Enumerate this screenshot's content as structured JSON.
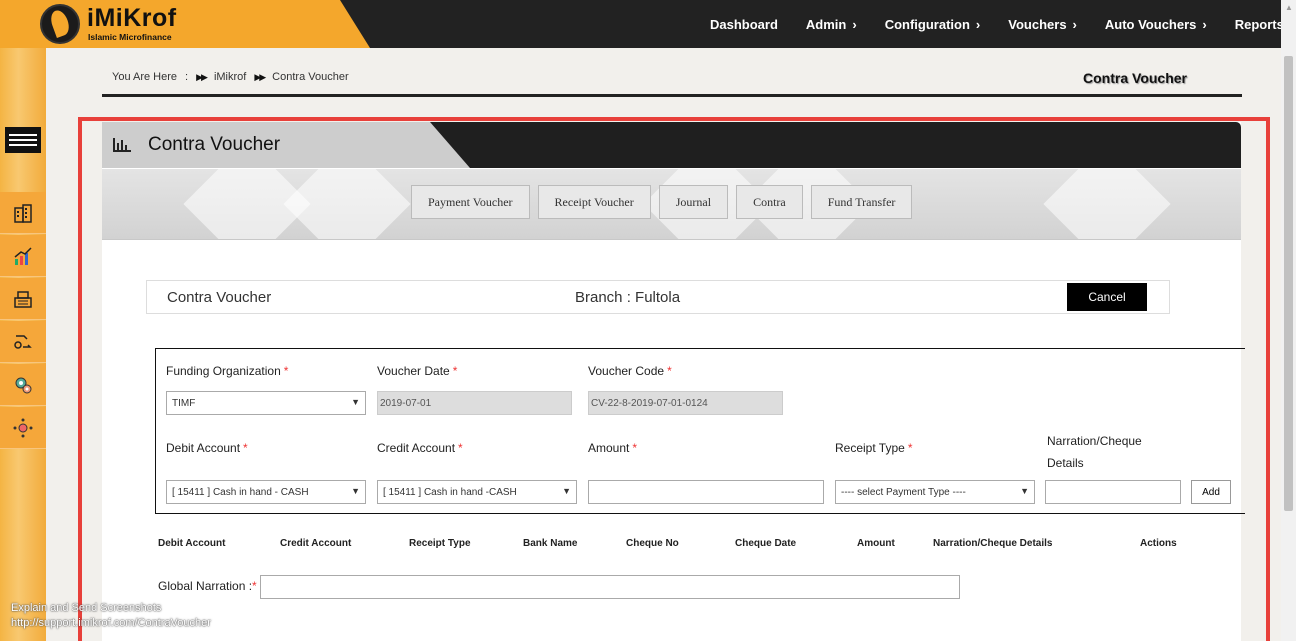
{
  "brand": {
    "name": "iMiKrof",
    "tagline": "Islamic Microfinance"
  },
  "nav": [
    {
      "label": "Dashboard",
      "chevron": false
    },
    {
      "label": "Admin",
      "chevron": true
    },
    {
      "label": "Configuration",
      "chevron": true
    },
    {
      "label": "Vouchers",
      "chevron": true
    },
    {
      "label": "Auto Vouchers",
      "chevron": true
    },
    {
      "label": "Reports",
      "chevron": true
    }
  ],
  "breadcrumb": {
    "prefix": "You Are Here",
    "separator": ":",
    "items": [
      "iMikrof",
      "Contra Voucher"
    ]
  },
  "page_heading": "Contra Voucher",
  "panel": {
    "title": "Contra Voucher"
  },
  "tabs": [
    "Payment Voucher",
    "Receipt Voucher",
    "Journal",
    "Contra",
    "Fund Transfer"
  ],
  "info": {
    "title": "Contra Voucher",
    "branch": "Branch : Fultola",
    "cancel_label": "Cancel"
  },
  "form": {
    "funding_org": {
      "label": "Funding Organization",
      "value": "TIMF"
    },
    "voucher_date": {
      "label": "Voucher Date",
      "value": "2019-07-01"
    },
    "voucher_code": {
      "label": "Voucher Code",
      "value": "CV-22-8-2019-07-01-0124"
    },
    "debit_account": {
      "label": "Debit Account",
      "value": "[ 15411 ] Cash in hand - CASH"
    },
    "credit_account": {
      "label": "Credit Account",
      "value": "[ 15411 ] Cash in hand -CASH"
    },
    "amount": {
      "label": "Amount",
      "value": ""
    },
    "receipt_type": {
      "label": "Receipt Type",
      "value": "---- select Payment Type ----"
    },
    "narration": {
      "label_line1": "Narration/Cheque",
      "label_line2": "Details",
      "value": ""
    },
    "add_label": "Add",
    "required_mark": "*"
  },
  "table_headers": [
    "Debit Account",
    "Credit Account",
    "Receipt Type",
    "Bank Name",
    "Cheque No",
    "Cheque Date",
    "Amount",
    "Narration/Cheque Details",
    "Actions"
  ],
  "global_narration": {
    "label": "Global Narration :",
    "value": ""
  },
  "status_bar": {
    "line1": "Explain and Send Screenshots",
    "line2": "http://support.imikrof.com/ContraVoucher"
  },
  "colors": {
    "accent": "#f4a72c",
    "header_dark": "#222222",
    "highlight": "#e8403a",
    "required": "#ee3333"
  }
}
